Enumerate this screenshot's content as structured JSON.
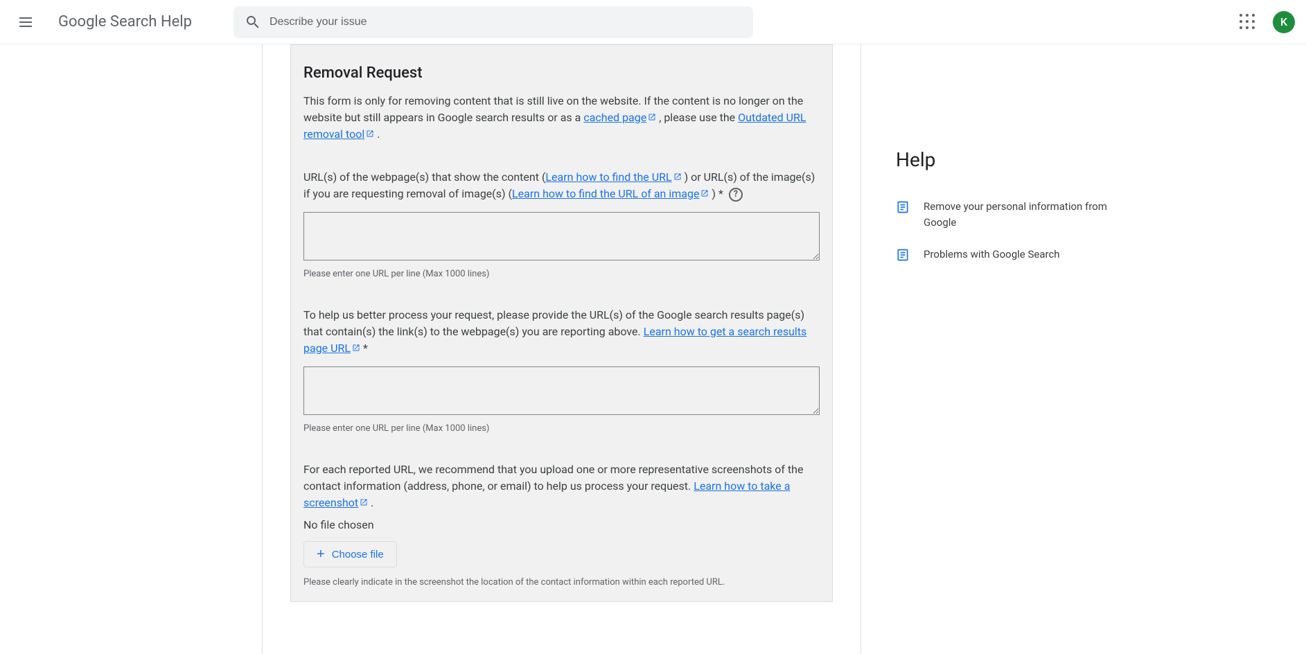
{
  "header": {
    "title": "Google Search Help",
    "search_placeholder": "Describe your issue",
    "avatar_letter": "K"
  },
  "form": {
    "title": "Removal Request",
    "intro_1": "This form is only for removing content that is still live on the website. If the content is no longer on the website but still appears in Google search results or as a ",
    "link_cached": "cached page",
    "intro_2": " , please use the ",
    "link_outdated": "Outdated URL removal tool",
    "intro_3": " .",
    "field1_pre": "URL(s) of the webpage(s) that show the content (",
    "field1_link1": "Learn how to find the URL",
    "field1_mid": " ) or URL(s) of the image(s) if you are requesting removal of image(s) (",
    "field1_link2": "Learn how to find the URL of an image",
    "field1_post": " ) *",
    "hint1": "Please enter one URL per line (Max 1000 lines)",
    "field2_pre": "To help us better process your request, please provide the URL(s) of the Google search results page(s) that contain(s) the link(s) to the webpage(s) you are reporting above.  ",
    "field2_link": "Learn how to get a search results page URL",
    "field2_post": "   *",
    "hint2": "Please enter one URL per line (Max 1000 lines)",
    "field3_pre": "For each reported URL, we recommend that you upload one or more representative screenshots of the contact information (address, phone, or email) to help us process your request. ",
    "field3_link": "Learn how to take a screenshot",
    "field3_post": " .",
    "no_file": "No file chosen",
    "choose_file": "Choose file",
    "upload_note": "Please clearly indicate in the screenshot the location of the contact information within each reported URL."
  },
  "sidebar": {
    "title": "Help",
    "items": [
      {
        "text": "Remove your personal information from Google"
      },
      {
        "text": "Problems with Google Search"
      }
    ]
  }
}
